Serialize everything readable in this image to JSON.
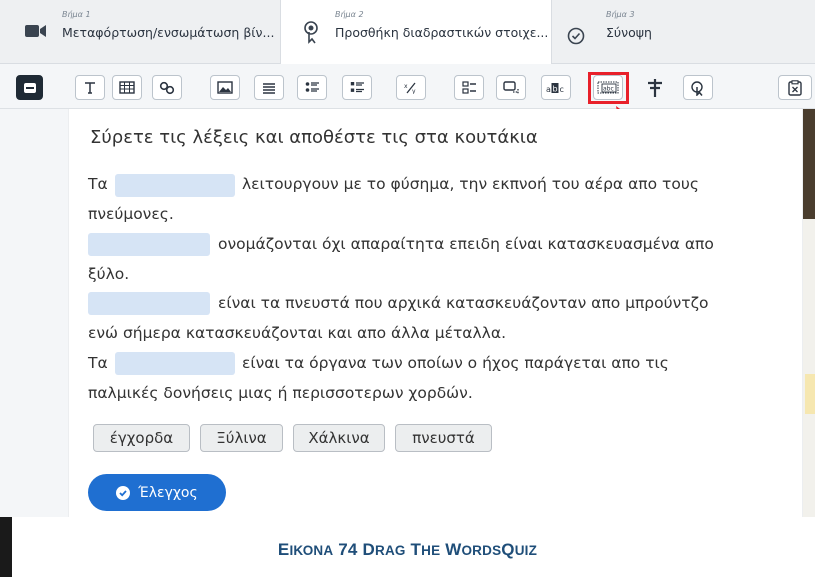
{
  "steps": [
    {
      "label": "Βήμα 1",
      "title": "Μεταφόρτωση/ενσωμάτωση βίν...",
      "icon": "video-camera-icon"
    },
    {
      "label": "Βήμα 2",
      "title": "Προσθήκη διαδραστικών στοιχε...",
      "icon": "pointer-tap-icon",
      "active": true
    },
    {
      "label": "Βήμα 3",
      "title": "Σύνοψη",
      "icon": "check-circle-icon"
    }
  ],
  "toolbar": {
    "tools": [
      "label-icon",
      "text-icon",
      "table-icon",
      "link-icon",
      "image-icon",
      "statements-icon",
      "single-choice-icon",
      "multiple-choice-icon",
      "fill-blanks-icon",
      "summary-icon",
      "drag-drop-icon",
      "mark-words-icon",
      "drag-words-icon",
      "crossroads-icon",
      "navigation-hotspot-icon",
      "submit-screen-icon"
    ],
    "highlighted_tool": "drag-words-icon",
    "highlight_color": "#e8202a"
  },
  "quiz": {
    "title": "Σύρετε τις λέξεις και αποθέστε τις στα κουτάκια",
    "line1_a": "Τα",
    "line1_b": "λειτουργουν με το φύσημα, την εκπνοή του αέρα απο τους",
    "line2": "πνεύμονες.",
    "line3": "ονομάζονται όχι απαραίτητα επειδη είναι κατασκευασμένα απο",
    "line4": "ξύλο.",
    "line5": "είναι τα πνευστά που αρχικά κατασκευάζονταν απο μπρούντζο",
    "line6": "ενώ σήμερα κατασκευάζονται και απο άλλα μέταλλα.",
    "line7_a": "Τα",
    "line7_b": "είναι τα όργανα των οποίων ο ήχος παράγεται απο τις",
    "line8": "παλμικές δονήσεις μιας ή περισσοτερων χορδών.",
    "words": [
      "έγχορδα",
      "Ξύλινα",
      "Χάλκινα",
      "πνευστά"
    ],
    "check_label": "Έλεγχος"
  },
  "caption": {
    "first_big": "Ε",
    "first_rest": "ΙΚΟΝΑ",
    "num": "74",
    "w1_big": "D",
    "w1_rest": "RAG",
    "w2_big": "T",
    "w2_rest": "HE",
    "w3_big": "W",
    "w3_rest": "ORDS",
    "w4_big": "Q",
    "w4_rest": "UIZ"
  },
  "colors": {
    "accent": "#1f6fd1",
    "caption": "#1f4e79",
    "drop_zone": "#d6e4f5"
  }
}
